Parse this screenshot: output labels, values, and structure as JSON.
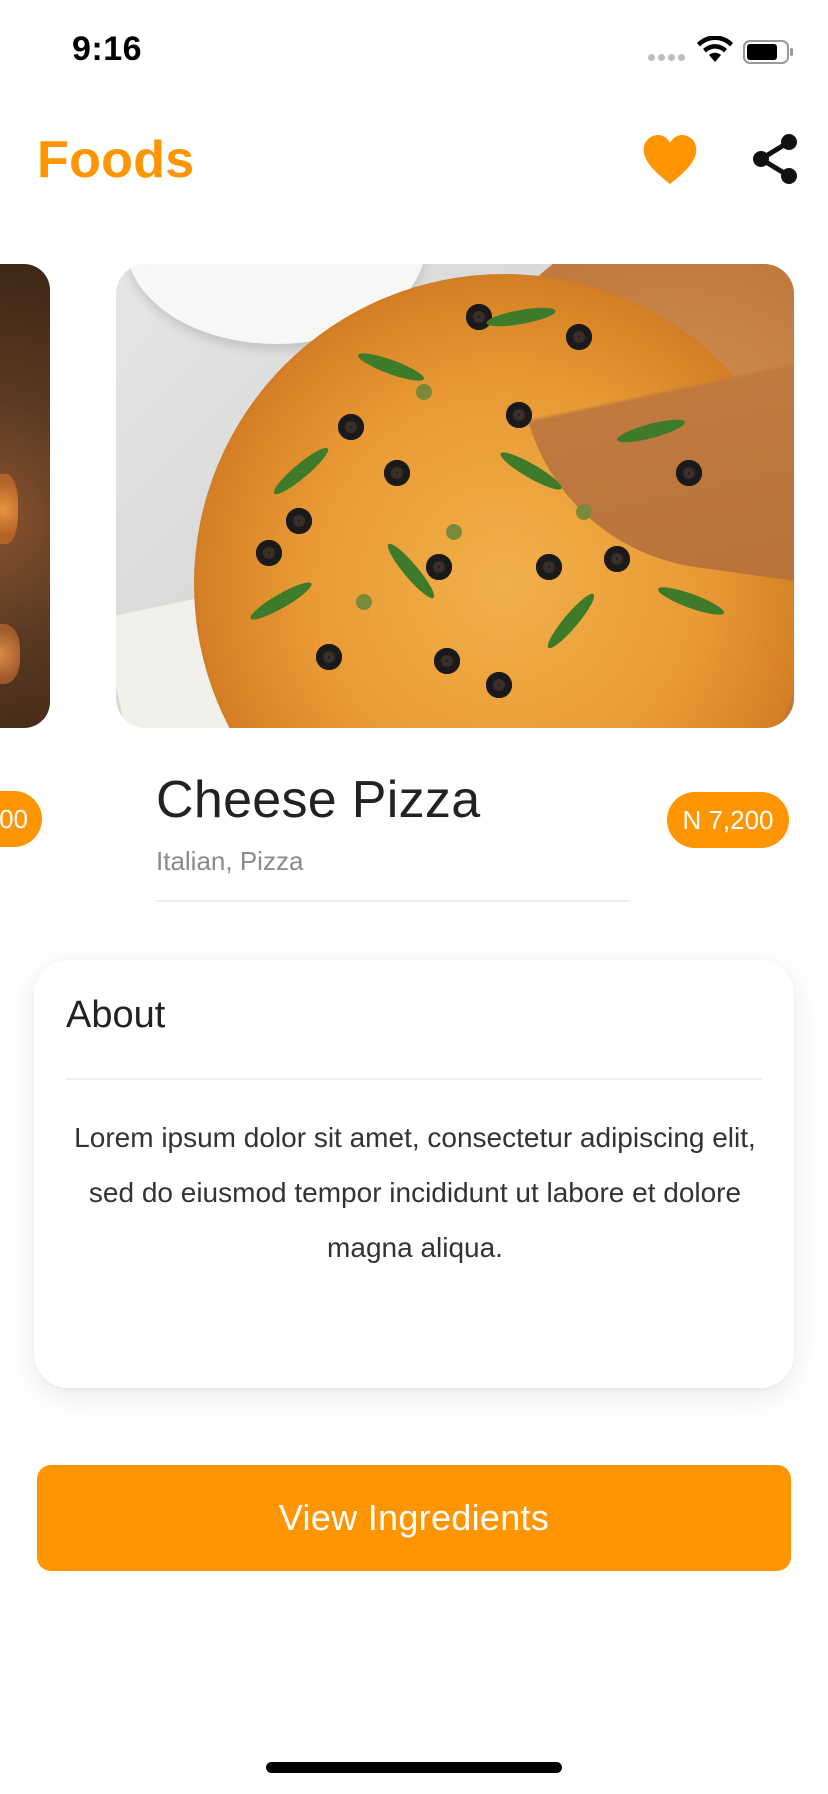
{
  "status_bar": {
    "time": "9:16"
  },
  "header": {
    "title": "Foods",
    "favorite_icon": "heart-icon",
    "share_icon": "share-icon"
  },
  "carousel": {
    "prev_item": {
      "price_partial": "00"
    },
    "current_item": {
      "name": "Cheese Pizza",
      "categories": "Italian, Pizza",
      "price": "N 7,200"
    }
  },
  "about": {
    "title": "About",
    "text": "Lorem ipsum dolor sit amet, consectetur adipiscing elit, sed do eiusmod tempor incididunt ut labore et dolore magna aliqua."
  },
  "actions": {
    "view_ingredients": "View Ingredients"
  },
  "colors": {
    "accent": "#FF9500",
    "text_primary": "#222222",
    "text_secondary": "#8A8A8A",
    "background": "#FFFFFF"
  }
}
